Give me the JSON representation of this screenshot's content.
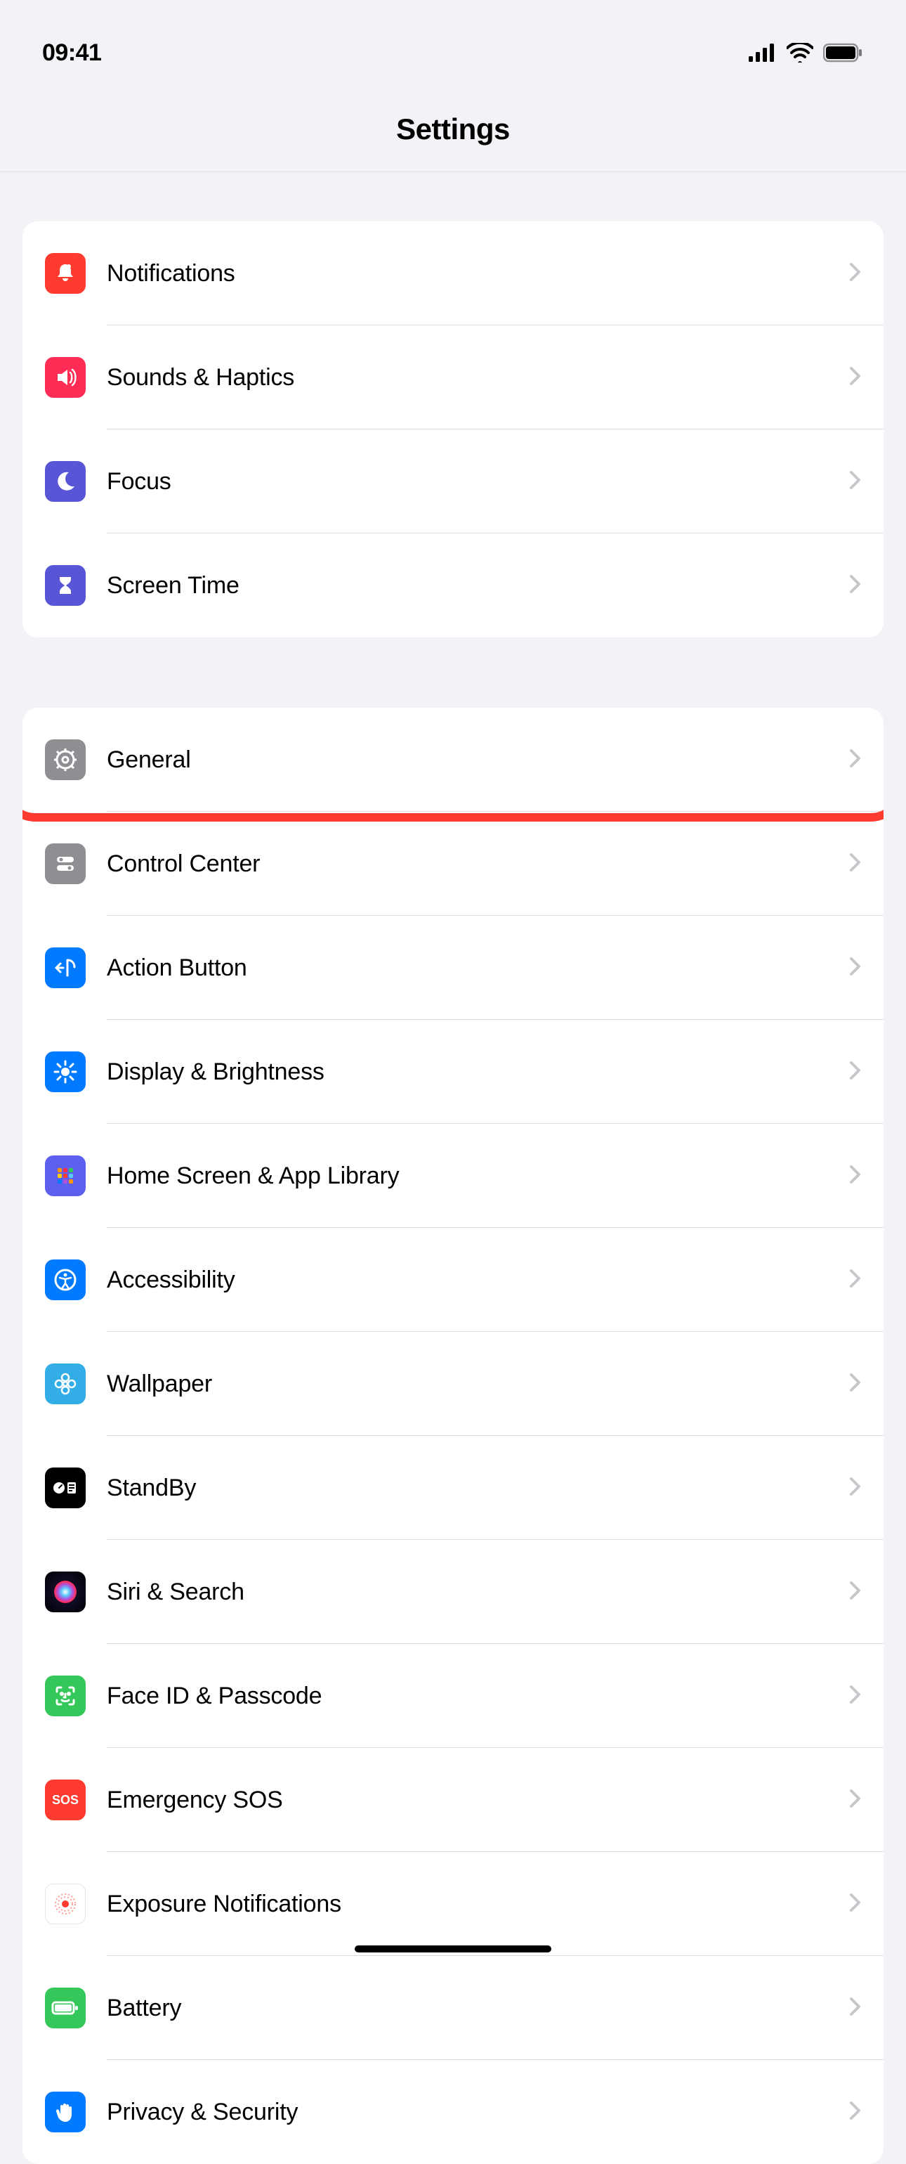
{
  "status": {
    "time": "09:41"
  },
  "header": {
    "title": "Settings"
  },
  "groups": [
    {
      "items": [
        {
          "id": "notifications",
          "label": "Notifications",
          "icon": "bell-icon",
          "bg": "ic-red"
        },
        {
          "id": "sounds",
          "label": "Sounds & Haptics",
          "icon": "speaker-icon",
          "bg": "ic-pink"
        },
        {
          "id": "focus",
          "label": "Focus",
          "icon": "moon-icon",
          "bg": "ic-indigo"
        },
        {
          "id": "screen-time",
          "label": "Screen Time",
          "icon": "hourglass-icon",
          "bg": "ic-indigo"
        }
      ]
    },
    {
      "items": [
        {
          "id": "general",
          "label": "General",
          "icon": "gear-icon",
          "bg": "ic-gray",
          "highlighted": true
        },
        {
          "id": "control-center",
          "label": "Control Center",
          "icon": "switches-icon",
          "bg": "ic-gray"
        },
        {
          "id": "action-button",
          "label": "Action Button",
          "icon": "action-icon",
          "bg": "ic-blue"
        },
        {
          "id": "display",
          "label": "Display & Brightness",
          "icon": "sun-icon",
          "bg": "ic-blue"
        },
        {
          "id": "home-screen",
          "label": "Home Screen & App Library",
          "icon": "apps-icon",
          "bg": "ic-purple"
        },
        {
          "id": "accessibility",
          "label": "Accessibility",
          "icon": "accessibility-icon",
          "bg": "ic-blue"
        },
        {
          "id": "wallpaper",
          "label": "Wallpaper",
          "icon": "flower-icon",
          "bg": "ic-cyan"
        },
        {
          "id": "standby",
          "label": "StandBy",
          "icon": "standby-icon",
          "bg": "ic-black"
        },
        {
          "id": "siri",
          "label": "Siri & Search",
          "icon": "siri-icon",
          "bg": "ic-siri"
        },
        {
          "id": "faceid",
          "label": "Face ID & Passcode",
          "icon": "faceid-icon",
          "bg": "ic-green"
        },
        {
          "id": "sos",
          "label": "Emergency SOS",
          "icon": "sos-icon",
          "bg": "ic-sos",
          "text": "SOS"
        },
        {
          "id": "exposure",
          "label": "Exposure Notifications",
          "icon": "exposure-icon",
          "bg": "ic-white"
        },
        {
          "id": "battery",
          "label": "Battery",
          "icon": "battery-icon",
          "bg": "ic-green"
        },
        {
          "id": "privacy",
          "label": "Privacy & Security",
          "icon": "hand-icon",
          "bg": "ic-hand"
        }
      ]
    }
  ]
}
